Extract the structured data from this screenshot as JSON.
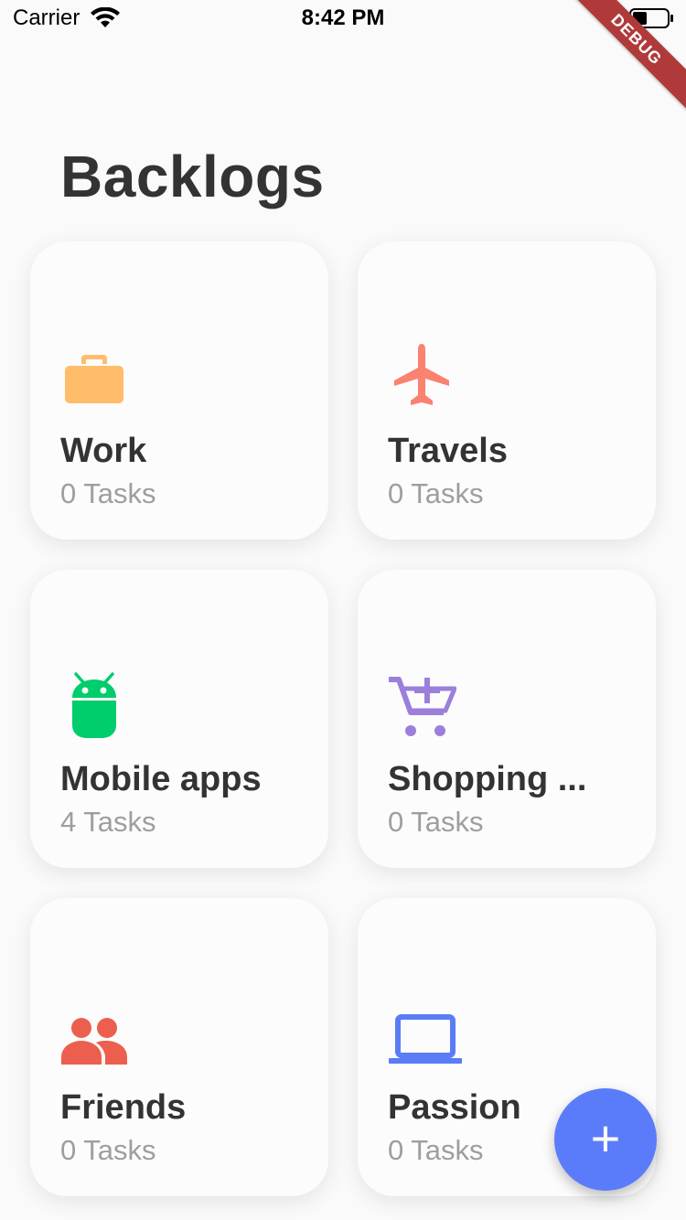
{
  "status_bar": {
    "carrier": "Carrier",
    "time": "8:42 PM"
  },
  "debug_banner": "DEBUG",
  "page_title": "Backlogs",
  "backlogs": [
    {
      "name": "Work",
      "count": "0 Tasks",
      "icon": "briefcase-icon",
      "color": "#ffbd6b"
    },
    {
      "name": "Travels",
      "count": "0 Tasks",
      "icon": "airplane-icon",
      "color": "#fb8171"
    },
    {
      "name": "Mobile apps",
      "count": "4 Tasks",
      "icon": "android-icon",
      "color": "#00cd6b"
    },
    {
      "name": "Shopping ...",
      "count": "0 Tasks",
      "icon": "add-shopping-cart-icon",
      "color": "#9b7fdb"
    },
    {
      "name": "Friends",
      "count": "0 Tasks",
      "icon": "people-icon",
      "color": "#ec5f4e"
    },
    {
      "name": "Passion",
      "count": "0 Tasks",
      "icon": "laptop-icon",
      "color": "#5a7cf6"
    }
  ],
  "fab": {
    "label": "+",
    "icon": "plus-icon",
    "color": "#5b7cfa"
  }
}
